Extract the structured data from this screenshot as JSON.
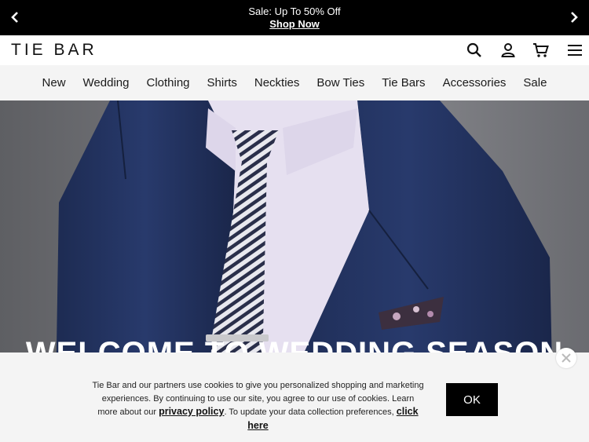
{
  "promo": {
    "line1": "Sale: Up To 50% Off",
    "line2": "Shop Now",
    "prev_icon": "chevron-left-icon",
    "next_icon": "chevron-right-icon"
  },
  "header": {
    "logo": "TIE BAR",
    "icons": [
      "search-icon",
      "account-icon",
      "cart-icon",
      "menu-icon"
    ]
  },
  "nav": {
    "items": [
      "New",
      "Wedding",
      "Clothing",
      "Shirts",
      "Neckties",
      "Bow Ties",
      "Tie Bars",
      "Accessories",
      "Sale"
    ]
  },
  "hero": {
    "title": "WELCOME TO WEDDING SEASON"
  },
  "cookie": {
    "text_part1": "Tie Bar and our partners use cookies to give you personalized shopping and marketing experiences. By continuing to use our site, you agree to our use of cookies. Learn more about our",
    "privacy_link": "privacy policy",
    "text_part2": ". To update your data collection preferences,",
    "click_here_link": "click here",
    "ok_label": "OK",
    "close_icon": "close-icon"
  },
  "colors": {
    "promo_bg": "#000000",
    "nav_bg": "#f4f4f4",
    "suit_navy": "#1f2f5a",
    "shirt_lavender": "#e6e0f0"
  }
}
